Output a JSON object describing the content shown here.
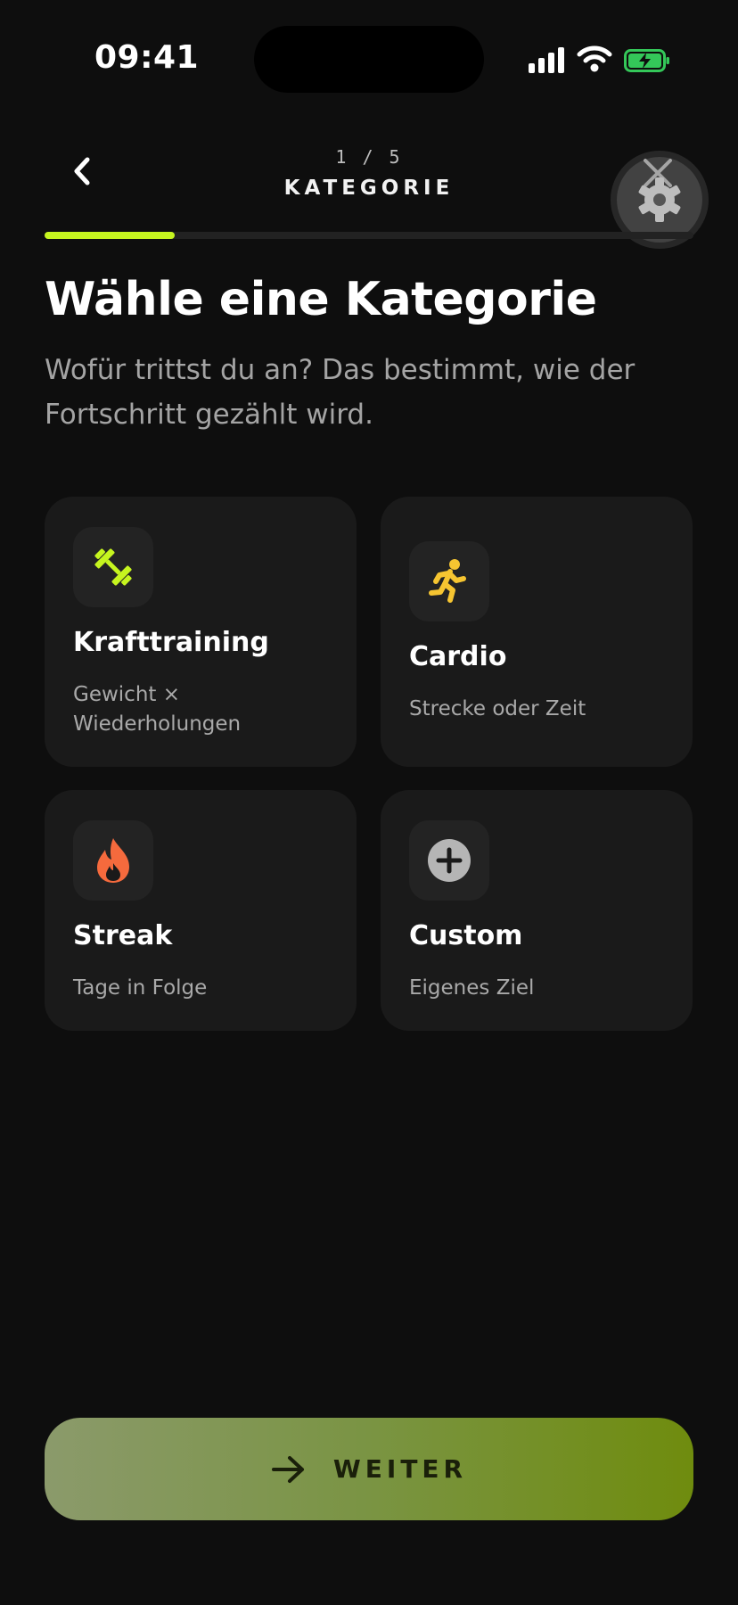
{
  "status_bar": {
    "time": "09:41"
  },
  "header": {
    "step": "1 / 5",
    "title": "KATEGORIE",
    "progress": 0.2
  },
  "main": {
    "title": "Wähle eine Kategorie",
    "subtitle": "Wofür trittst du an? Das bestimmt, wie der Fortschritt gezählt wird."
  },
  "categories": [
    {
      "title": "Krafttraining",
      "desc": "Gewicht × Wiederholungen",
      "icon": "dumbbell-icon",
      "color": "#c6f51f"
    },
    {
      "title": "Cardio",
      "desc": "Strecke oder Zeit",
      "icon": "runner-icon",
      "color": "#f6c531"
    },
    {
      "title": "Streak",
      "desc": "Tage in Folge",
      "icon": "flame-icon",
      "color": "#f56a3d"
    },
    {
      "title": "Custom",
      "desc": "Eigenes Ziel",
      "icon": "plus-circle-icon",
      "color": "#b5b5b5"
    }
  ],
  "cta": {
    "label": "WEITER"
  },
  "colors": {
    "accent": "#c6f51f",
    "background": "#0e0e0e",
    "card": "#1a1a1a"
  }
}
